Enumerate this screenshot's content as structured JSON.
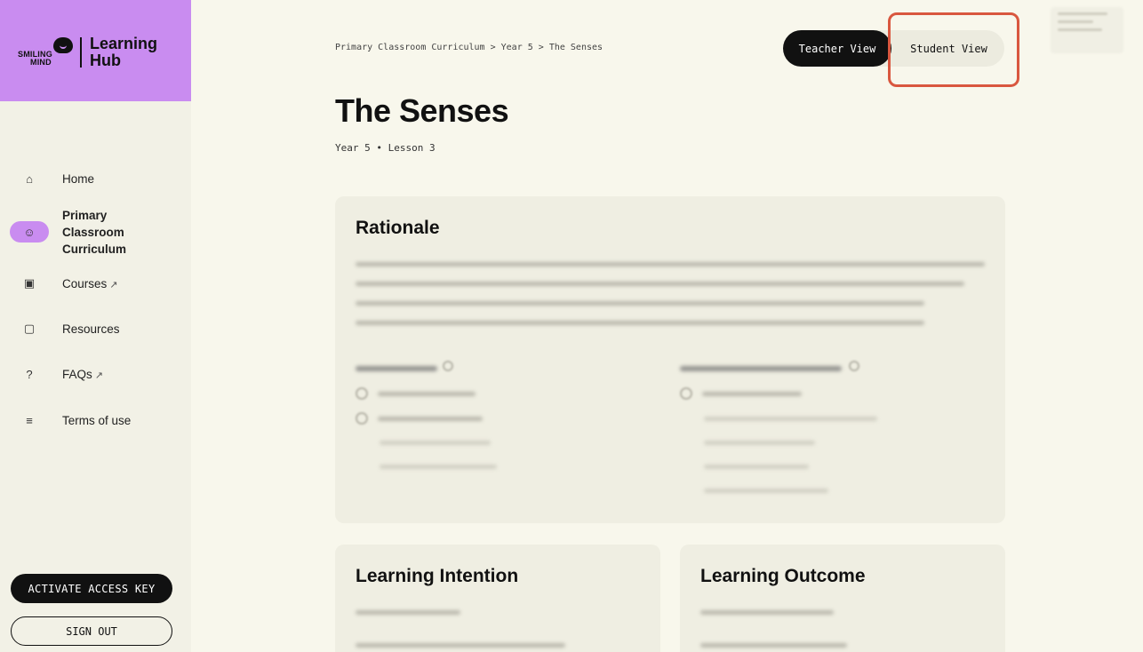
{
  "brand": {
    "logo_line1": "SMILING",
    "logo_line2": "MIND",
    "title_line1": "Learning",
    "title_line2": "Hub"
  },
  "nav": [
    {
      "label": "Home",
      "icon": "home-icon",
      "glyph": "⌂"
    },
    {
      "label_lines": [
        "Primary",
        "Classroom",
        "Curriculum"
      ],
      "icon": "smile-icon",
      "glyph": "☺"
    },
    {
      "label": "Courses",
      "icon": "monitor-icon",
      "glyph": "▣",
      "external": "↗"
    },
    {
      "label": "Resources",
      "icon": "folder-icon",
      "glyph": "▢"
    },
    {
      "label": "FAQs",
      "icon": "question-icon",
      "glyph": "?",
      "external": "↗"
    },
    {
      "label": "Terms of use",
      "icon": "list-icon",
      "glyph": "≡"
    }
  ],
  "buttons": {
    "activate": "ACTIVATE ACCESS KEY",
    "sign_out": "SIGN OUT"
  },
  "breadcrumb": "Primary Classroom Curriculum > Year 5 > The Senses",
  "view_toggle": {
    "teacher": "Teacher View",
    "student": "Student View"
  },
  "page": {
    "title": "The Senses",
    "meta": "Year 5 • Lesson 3"
  },
  "cards": {
    "rationale": "Rationale",
    "intention": "Learning Intention",
    "outcome": "Learning Outcome"
  },
  "colors": {
    "accent": "#c98cf0",
    "highlight": "#d9573f",
    "background": "#f8f7ec"
  }
}
